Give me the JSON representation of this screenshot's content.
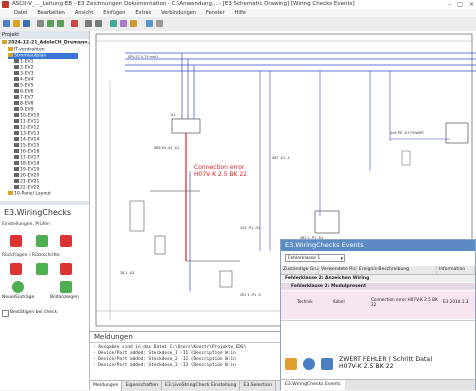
{
  "title": "ASCII-V_..._Leitung EB - E3 Zeichnungen Dokumentation - C:\\Anwendung... - [E3 Schematic Drawing] [Wiring Checks Events]",
  "window_controls": {
    "min": "–",
    "max": "□",
    "close": "×"
  },
  "menu": [
    "Datei",
    "Bearbeiten",
    "Ansicht",
    "Einfügen",
    "Extras",
    "Verbindungen",
    "Fenster",
    "Hilfe"
  ],
  "project_tree": {
    "panel_title": "Projekt",
    "root": "2024-12-21_AdoleCH_Dremann...",
    "items": [
      "IT-verdrahten",
      "Stromlaufplan",
      "1-EV1",
      "2-EV2",
      "3-EV3",
      "4-EV4",
      "5-EV5",
      "6-EV6",
      "7-EV7",
      "8-EV8",
      "9-EV9",
      "10-EV10",
      "11-EV11",
      "12-EV12",
      "13-EV13",
      "14-EV14",
      "15-EV15",
      "16-EV16",
      "17-EV17",
      "18-EV18",
      "19-EV19",
      "20-EV20",
      "21-EV21",
      "22-EV22",
      "23-EV23",
      "24-EV24",
      "25-EV25",
      "26-EV26",
      "27-EV27",
      "10-Panel Layout"
    ]
  },
  "wiring_checks": {
    "title": "E3.WiringChecks",
    "section1": "Einstellungen, Prüfen",
    "section2": "Rückfragen / Rückschritte",
    "item_settings": "Neue/Einträge",
    "item_display": "Bildanzeigen",
    "checkbox_label": "Bestätigen bei check"
  },
  "canvas": {
    "error_line1": "Connection error",
    "error_line2": "H07V-K 2.5 BK 22",
    "ref_label": "2x6 PE -X1 POWER",
    "wire_labels": [
      "SPV-S1 0.75 mm2",
      "-X1",
      "-K2",
      "-F1",
      "-Q1",
      "-Q2",
      "-M1"
    ],
    "designations": [
      "SB8 E4 -X1 -S1",
      "SB7 -K1 -1",
      "2X1 -P1 -H1",
      "2B 1 -A3",
      "SB2 1 -P1 -R1",
      "2E2 1 -P1 -3"
    ]
  },
  "messages": {
    "title": "Meldungen",
    "lines": [
      "- Ausgaben sind in das Datei C:\\Users\\Konstr\\Projekte_EDS\\",
      "- Device/Part added: Steckdose_1 -I1 (Description W:in",
      "- Device/Part added: Steckdose_2 -I2 (Description W:in",
      "- Device/Part added: Steckdose_3 -I3 (Description W:in"
    ]
  },
  "events": {
    "title": "E3.WiringChecks Events",
    "filter_label": "Fehlerklasse 1",
    "columns": [
      "Zuständige Gruppe",
      "Verwendete Richtlinie",
      "Ereignis-Beschreibung",
      "Information"
    ],
    "group_row": "Fehlerklasse 2: Anzeichen Wiring",
    "subgroup_row": "Fehlerklasse 2: Modulpresent",
    "row": [
      "Technik",
      "Kabel",
      "Connection error H07V-K 2.5 BK 22",
      "E3:2014.1.3"
    ],
    "detail_line1": "ZWERT FEHLER ( Schritt Data)",
    "detail_line2": "H07V-K 2.5 BK 22",
    "tab": "E3.WiringChecks Events"
  },
  "bottom_tabs": [
    "Meldungen",
    "Eigenschaften",
    "E3.LiveStringCheck Einstellung",
    "E3.Selection"
  ],
  "colors": {
    "accent": "#5b8ac4",
    "error": "#e02020",
    "wire": "#3b4ad0"
  }
}
